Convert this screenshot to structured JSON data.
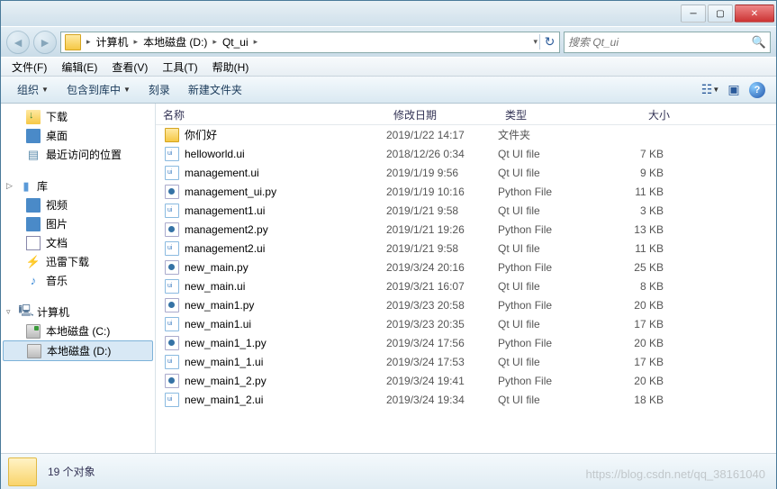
{
  "breadcrumb": [
    "计算机",
    "本地磁盘 (D:)",
    "Qt_ui"
  ],
  "search_placeholder": "搜索 Qt_ui",
  "menu": {
    "file": "文件(F)",
    "edit": "编辑(E)",
    "view": "查看(V)",
    "tools": "工具(T)",
    "help": "帮助(H)"
  },
  "toolbar": {
    "organize": "组织",
    "include": "包含到库中",
    "burn": "刻录",
    "newfolder": "新建文件夹"
  },
  "columns": {
    "name": "名称",
    "date": "修改日期",
    "type": "类型",
    "size": "大小"
  },
  "sidebar": {
    "downloads": "下载",
    "desktop": "桌面",
    "recent": "最近访问的位置",
    "libraries": "库",
    "videos": "视频",
    "pictures": "图片",
    "documents": "文档",
    "xunlei": "迅雷下载",
    "music": "音乐",
    "computer": "计算机",
    "drive_c": "本地磁盘 (C:)",
    "drive_d": "本地磁盘 (D:)"
  },
  "files": [
    {
      "name": "你们好",
      "date": "2019/1/22 14:17",
      "type": "文件夹",
      "size": "",
      "icon": "folder"
    },
    {
      "name": "helloworld.ui",
      "date": "2018/12/26 0:34",
      "type": "Qt UI file",
      "size": "7 KB",
      "icon": "ui"
    },
    {
      "name": "management.ui",
      "date": "2019/1/19 9:56",
      "type": "Qt UI file",
      "size": "9 KB",
      "icon": "ui"
    },
    {
      "name": "management_ui.py",
      "date": "2019/1/19 10:16",
      "type": "Python File",
      "size": "11 KB",
      "icon": "py"
    },
    {
      "name": "management1.ui",
      "date": "2019/1/21 9:58",
      "type": "Qt UI file",
      "size": "3 KB",
      "icon": "ui"
    },
    {
      "name": "management2.py",
      "date": "2019/1/21 19:26",
      "type": "Python File",
      "size": "13 KB",
      "icon": "py"
    },
    {
      "name": "management2.ui",
      "date": "2019/1/21 9:58",
      "type": "Qt UI file",
      "size": "11 KB",
      "icon": "ui"
    },
    {
      "name": "new_main.py",
      "date": "2019/3/24 20:16",
      "type": "Python File",
      "size": "25 KB",
      "icon": "py"
    },
    {
      "name": "new_main.ui",
      "date": "2019/3/21 16:07",
      "type": "Qt UI file",
      "size": "8 KB",
      "icon": "ui"
    },
    {
      "name": "new_main1.py",
      "date": "2019/3/23 20:58",
      "type": "Python File",
      "size": "20 KB",
      "icon": "py"
    },
    {
      "name": "new_main1.ui",
      "date": "2019/3/23 20:35",
      "type": "Qt UI file",
      "size": "17 KB",
      "icon": "ui"
    },
    {
      "name": "new_main1_1.py",
      "date": "2019/3/24 17:56",
      "type": "Python File",
      "size": "20 KB",
      "icon": "py"
    },
    {
      "name": "new_main1_1.ui",
      "date": "2019/3/24 17:53",
      "type": "Qt UI file",
      "size": "17 KB",
      "icon": "ui"
    },
    {
      "name": "new_main1_2.py",
      "date": "2019/3/24 19:41",
      "type": "Python File",
      "size": "20 KB",
      "icon": "py"
    },
    {
      "name": "new_main1_2.ui",
      "date": "2019/3/24 19:34",
      "type": "Qt UI file",
      "size": "18 KB",
      "icon": "ui"
    }
  ],
  "status": {
    "count": "19 个对象"
  },
  "watermark": "https://blog.csdn.net/qq_38161040"
}
